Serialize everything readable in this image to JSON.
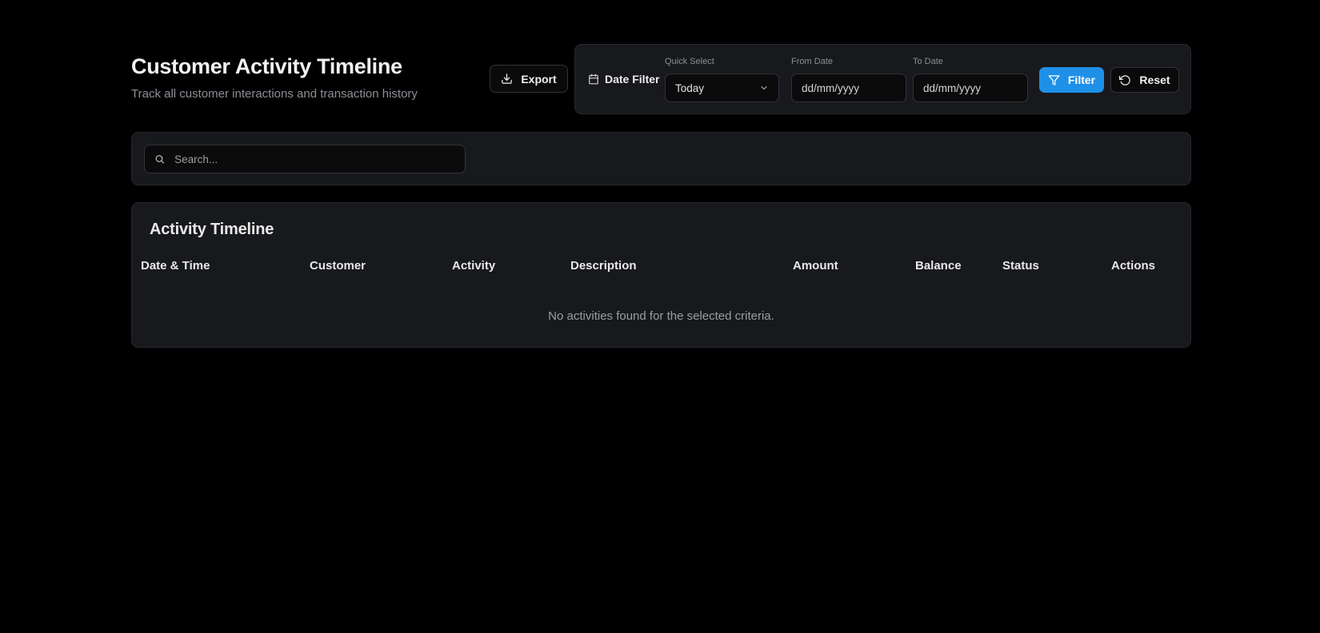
{
  "header": {
    "title": "Customer Activity Timeline",
    "subtitle": "Track all customer interactions and transaction history",
    "export_label": "Export"
  },
  "date_filter": {
    "heading": "Date Filter",
    "quick_select_label": "Quick Select",
    "quick_select_value": "Today",
    "from_label": "From Date",
    "from_placeholder": "dd/mm/yyyy",
    "to_label": "To Date",
    "to_placeholder": "dd/mm/yyyy",
    "filter_label": "Filter",
    "reset_label": "Reset"
  },
  "search": {
    "placeholder": "Search..."
  },
  "timeline": {
    "title": "Activity Timeline",
    "columns": [
      "Date & Time",
      "Customer",
      "Activity",
      "Description",
      "Amount",
      "Balance",
      "Status",
      "Actions"
    ],
    "empty_message": "No activities found for the selected criteria."
  },
  "colors": {
    "background": "#000000",
    "panel": "#18191c",
    "accent": "#1e90e8"
  },
  "icons": {
    "export": "download-icon",
    "date_filter": "calendar-icon",
    "select": "chevron-down-icon",
    "filter": "funnel-icon",
    "reset": "rotate-ccw-icon",
    "search": "search-icon"
  }
}
